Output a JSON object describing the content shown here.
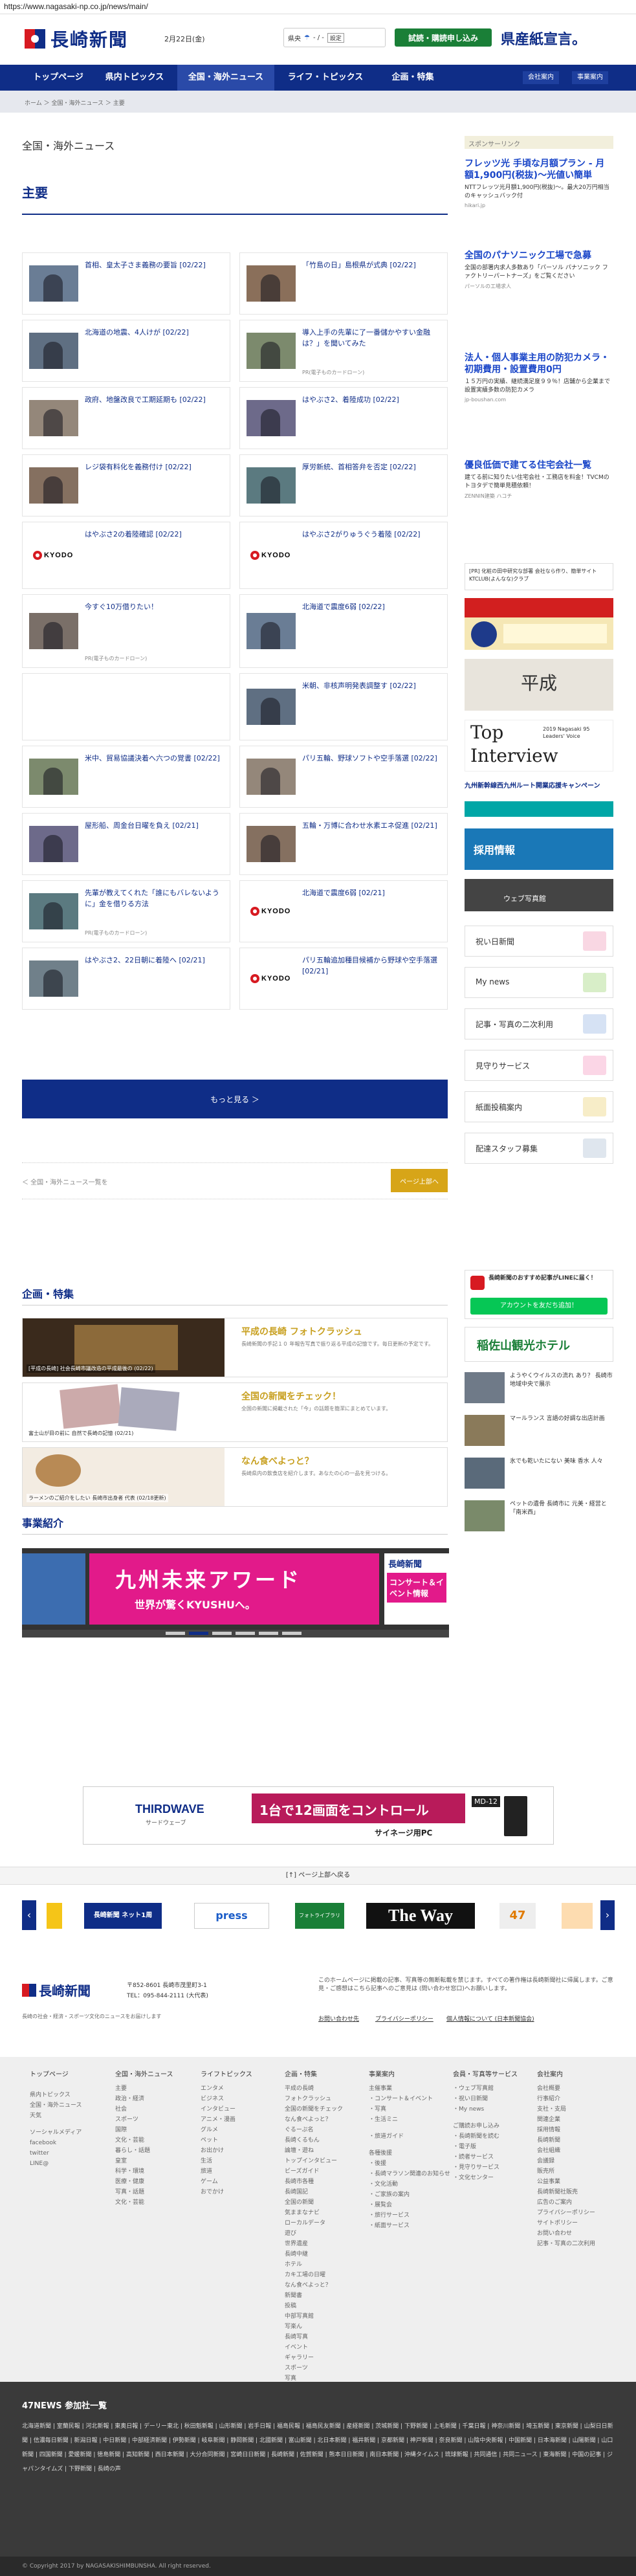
{
  "browser": {
    "url": "https://www.nagasaki-np.co.jp/news/main/"
  },
  "header": {
    "logo_text": "長崎新聞",
    "date": "2月22日(金)",
    "weather_place": "県央",
    "weather_temp": "- / -",
    "weather_set": "設定",
    "trial_label": "試読・購読申し込み",
    "banner_text": "県産紙宣言。"
  },
  "nav": {
    "items": [
      "トップページ",
      "県内トピックス",
      "全国・海外ニュース",
      "ライフ・トピックス",
      "企画・特集"
    ],
    "sub": [
      "会社案内",
      "事業案内"
    ]
  },
  "breadcrumb": "ホーム ＞ 全国・海外ニュース ＞ 主要",
  "main": {
    "section_title": "全国・海外ニュース",
    "heading": "主要",
    "cards": [
      {
        "title": "首相、皇太子さま義務の要旨 [02/22]",
        "kind": "photo"
      },
      {
        "title": "「竹島の日」島根県が式典 [02/22]",
        "kind": "photo"
      },
      {
        "title": "北海道の地震、4人けが [02/22]",
        "kind": "photo"
      },
      {
        "title": "導入上手の先輩に了一番儲かやすい金融は？」を聞いてみた",
        "kind": "pr",
        "pr": "PR(電子ものカードローン)"
      },
      {
        "title": "政府、地盤改良で工期延期も [02/22]",
        "kind": "photo"
      },
      {
        "title": "はやぶさ2、着陸成功 [02/22]",
        "kind": "photo"
      },
      {
        "title": "レジ袋有料化を義務付け [02/22]",
        "kind": "photo"
      },
      {
        "title": "厚労新統、首相答弁を否定 [02/22]",
        "kind": "photo"
      },
      {
        "title": "はやぶさ2の着陸確認 [02/22]",
        "kind": "kyodo"
      },
      {
        "title": "はやぶさ2がりゅうぐう着陸 [02/22]",
        "kind": "kyodo"
      },
      {
        "title": "今すぐ10万借りたい！",
        "kind": "pr",
        "pr": "PR(電子ものカードローン)"
      },
      {
        "title": "北海道で震度6弱 [02/22]",
        "kind": "photo"
      },
      {
        "title": "",
        "kind": "blank"
      },
      {
        "title": "米朝、非核声明発表調整す [02/22]",
        "kind": "photo"
      },
      {
        "title": "米中、貿易協議決着へ六つの覚書 [02/22]",
        "kind": "photo"
      },
      {
        "title": "パリ五輪、野球ソフトや空手落選 [02/22]",
        "kind": "photo"
      },
      {
        "title": "屋形船、周金台日曜を負え [02/21]",
        "kind": "photo"
      },
      {
        "title": "五輪・万博に合わせ水素エネ促進 [02/21]",
        "kind": "photo"
      },
      {
        "title": "先輩が教えてくれた「誰にもバレないように」金を借りる方法",
        "kind": "pr",
        "pr": "PR(電子ものカードローン)"
      },
      {
        "title": "北海道で震度6弱 [02/21]",
        "kind": "kyodo"
      },
      {
        "title": "はやぶさ2、22日朝に着陸へ [02/21]",
        "kind": "photo"
      },
      {
        "title": "パリ五輪追加種目候補から野球や空手落選 [02/21]",
        "kind": "kyodo"
      }
    ],
    "more_label": "もっと見る ＞",
    "back_label": "＜ 全国・海外ニュース一覧を",
    "pagetop_label": "ページ上部へ"
  },
  "features": {
    "heading": "企画・特集",
    "items": [
      {
        "title": "平成の長崎 フォトクラッシュ",
        "caption": "[平成の長崎] 社会長崎市議改造の平成最後の (02/22)",
        "desc": "長崎新聞の手記１０ 年報告写真で振り返る平成の記憶です。毎日更新の予定です。"
      },
      {
        "title": "全国の新聞をチェック！",
        "caption": "富士山が目の前に 自然で長崎の記憶 (02/21)",
        "desc": "全国の新聞に掲載された「今」の話題を簡潔にまとめています。"
      },
      {
        "title": "なん食べよっと？",
        "caption": "ラーメンのご紹介をしたい 長崎市出身者 代表 (02/18更新)",
        "desc": "長崎県内の飲食店を紹介します。あなたの心の一品を見つける。"
      }
    ]
  },
  "jigyo": {
    "heading": "事業紹介",
    "slide_main": "九州未来アワード",
    "slide_main_sub": "世界が驚くKYUSHUへ。",
    "slide_side": "長崎新聞",
    "slide_side_sub": "コンサート＆イベント情報"
  },
  "sidebar": {
    "sponsor_label": "スポンサーリンク",
    "ads": [
      {
        "title": "フレッツ光 手頃な月額プラン - 月額1,900円(税抜)～光値い簡単",
        "sub": "NTTフレッツ光月額1,900円(税抜)～。最大20万円相当のキャッシュバック付",
        "url": "hikari.jp"
      },
      {
        "title": "全国のパナソニック工場で急募",
        "sub": "全国の部署内求人多数あり「パーソル パナソニック ファクトリーパートナーズ」をご覧ください",
        "url": "パーソルの工場求人"
      },
      {
        "title": "法人・個人事業主用の防犯カメラ・初期費用・設置費用0円",
        "sub": "１５万円の実績、継続満足度９９％！店舗から企業まで設置実績多数の防犯カメラ",
        "url": "jp-boushan.com"
      },
      {
        "title": "優良低価で建てる住宅会社一覧",
        "sub": "建てる前に知りたい住宅会社・工務店を料金！TVCMのトヨタデで簡単見積依頼！",
        "url": "ZENNIN建築 ハコチ"
      }
    ],
    "small_ad": "[PR] 化粧の田中研究な部署 会社なら作り、簡単サイト KTCLUB(よんなな)クラブ",
    "buttons": [
      "祝い日新聞",
      "My news",
      "記事・写真の二次利用",
      "見守りサービス",
      "紙面投稿案内",
      "配達スタッフ募集"
    ],
    "line_label": "長崎新聞のおすすめ記事がLINEに届く！",
    "line_btn": "アカウントを友だち追加！",
    "hotel": "稲佐山観光ホテル",
    "recruit": "採用情報",
    "shashin": "ウェブ写真館",
    "heisei": "平成",
    "interview_top": "Top",
    "interview_main": "Interview",
    "interview_badge": "2019 Nagasaki 95 Leaders' Voice",
    "campaign": "九州新幹線西九州ルート開業応援キャンペーン",
    "news_items": [
      "ようやくウイルスの流れ あり？ 長崎市地域中央で展示",
      "マールランス 言語の好調な出店計画",
      "氷でも乾いたにない 美味 香水 人々",
      "ペットの遺骨 長崎市に 元美・経営と「南米西」"
    ]
  },
  "wide_ad": {
    "brand": "THIRDWAVE",
    "brand_sub": "サードウェーブ",
    "title": "1台で12画面をコントロール",
    "sub": "サイネージ用PC",
    "model": "MD-12"
  },
  "pagetop_bar": "[↑] ページ上部へ戻る",
  "carousel_items": [
    "長崎新聞 ネット1周",
    "press",
    "フォトライブラリ",
    "The Way",
    "47"
  ],
  "footer": {
    "logo_text": "長崎新聞",
    "address": "〒852-8601 長崎市茂里町3-1",
    "tel": "TEL：095-844-2111 (大代表)",
    "tagline": "長崎の社会・経済・スポーツ文化のニュースをお届けします",
    "notice": "このホームページに掲載の記事、写真等の無断転載を禁じます。すべての著作権は長崎新聞社に帰属します。ご意見・ご感想はこちら記事へのご意見は (問い合わせ窓口)へお願いします。",
    "links2": [
      "お問い合わせ先",
      "プライバシーポリシー",
      "個人情報について (日本新聞協会)"
    ],
    "columns": [
      {
        "head": "トップページ",
        "items": [
          "",
          "県内トピックス",
          "全国・海外ニュース",
          "天気",
          "",
          "ソーシャルメディア",
          "facebook",
          "twitter",
          "LINE@"
        ]
      },
      {
        "head": "全国・海外ニュース",
        "items": [
          "主要",
          "政治・経済",
          "社会",
          "スポーツ",
          "国際",
          "文化・芸能",
          "暮らし・話題",
          "皇室",
          "科学・環境",
          "医療・健康",
          "写真・話題",
          "文化・芸能"
        ]
      },
      {
        "head": "ライフトピックス",
        "items": [
          "エンタメ",
          "ビジネス",
          "インタビュー",
          "アニメ・漫画",
          "グルメ",
          "ペット",
          "お出かけ",
          "生活",
          "旅道",
          "ゲーム",
          "おでかけ"
        ]
      },
      {
        "head": "企画・特集",
        "items": [
          "平成の長崎",
          "フォトクラッシュ",
          "全国の新聞をチェック",
          "なん食べよっと？",
          "ぐるーぷ名",
          "長崎くるもん",
          "論壇・遊ね",
          "トップインタビュー",
          "ビーズガイド",
          "長崎市各種",
          "長崎国記",
          "全国の新聞",
          "気ままなナビ",
          "ローカルデータ",
          "遊び",
          "世界遺産",
          "長崎中継",
          "ホテル",
          "カキ工場の日曜",
          "なん食べよっと？",
          "新聞書",
          "投稿",
          "中部写真館",
          "写楽ん",
          "長崎写真",
          "イベント",
          "ギャラリー",
          "スポーツ",
          "写真",
          "鮮度",
          "記者の画像",
          "飲酒ランキング"
        ]
      },
      {
        "head": "事業案内",
        "items": [
          "主催事業",
          "・コンサート＆イベント",
          "・写真",
          "・生活ミニ",
          "",
          "・旅道ガイド",
          "",
          "各種後援",
          "・後援",
          "・長崎マラソン関連のお知らせ",
          "・文化活動",
          "・ご家族の案内",
          "・展覧会",
          "・旅行サービス",
          "・紙面サービス"
        ]
      },
      {
        "head": "会員・写真等サービス",
        "items": [
          "・ウェブ写真館",
          "・祝い日新聞",
          "・My news",
          "",
          "ご購読お申し込み",
          "・長崎新聞を読む",
          "・電子版",
          "・読者サービス",
          "・見守りサービス",
          "・文化センター"
        ]
      },
      {
        "head": "会社案内",
        "items": [
          "会社概要",
          "行事紹介",
          "支社・支局",
          "関連企業",
          "採用情報",
          "長崎新聞",
          "会社組織",
          "会議録",
          "販売所",
          "公益事業",
          "長崎新聞社販売",
          "広告のご案内",
          "プライバシーポリシー",
          "サイトポリシー",
          "お問い合わせ",
          "記事・写真の二次利用"
        ]
      }
    ]
  },
  "n47": {
    "title": "47NEWS 参加社一覧",
    "links": "北海道新聞 | 室蘭民報 | 河北新報 | 東奥日報 | デーリー東北 | 秋田魁新報 | 山形新聞 | 岩手日報 | 福島民報 | 福島民友新聞 | 産経新聞 | 茨城新聞 | 下野新聞 | 上毛新聞 | 千葉日報 | 神奈川新聞 | 埼玉新聞 | 東京新聞 | 山梨日日新聞 | 信濃毎日新聞 | 新潟日報 | 中日新聞 | 中部経済新聞 | 伊勢新聞 | 岐阜新聞 | 静岡新聞 | 北國新聞 | 富山新聞 | 北日本新聞 | 福井新聞 | 京都新聞 | 神戸新聞 | 奈良新聞 | 山陰中央新報 | 中国新聞 | 日本海新聞 | 山陽新聞 | 山口新聞 | 四国新聞 | 愛媛新聞 | 徳島新聞 | 高知新聞 | 西日本新聞 | 大分合同新聞 | 宮崎日日新聞 | 長崎新聞 | 佐賀新聞 | 熊本日日新聞 | 南日本新聞 | 沖縄タイムス | 琉球新報 | 共同通信 | 共同ニュース | 東海新聞 | 中国の記事 | ジャパンタイムズ | 下野新聞 | 長崎の声"
  },
  "copyright": "© Copyright 2017 by NAGASAKISHIMBUNSHA. All right reserved.",
  "colors": {
    "navy": "#0f2d87",
    "gold": "#d7a518",
    "green": "#1a7f37",
    "kyodo_red": "#d71a21",
    "line_green": "#06c755"
  }
}
